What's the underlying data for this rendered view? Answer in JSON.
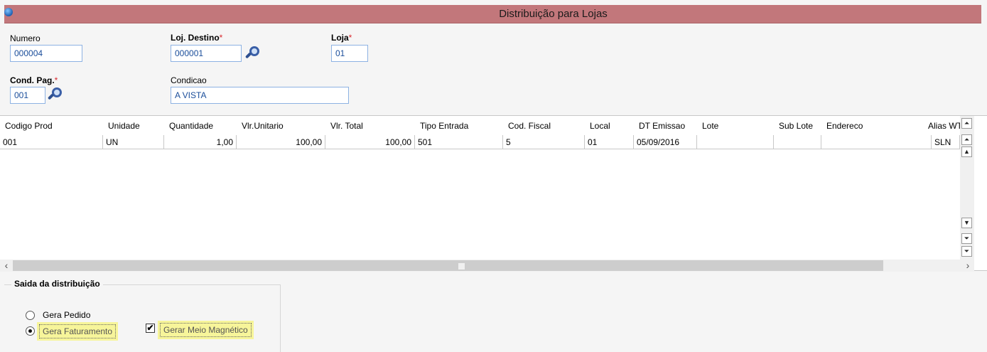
{
  "window": {
    "title": "Distribuição para Lojas"
  },
  "form": {
    "numero": {
      "label": "Numero",
      "value": "000004"
    },
    "loj_destino": {
      "label": "Loj. Destino",
      "required_mark": "*",
      "value": "000001"
    },
    "loja": {
      "label": "Loja",
      "required_mark": "*",
      "value": "01"
    },
    "cond_pag": {
      "label": "Cond. Pag.",
      "required_mark": "*",
      "value": "001"
    },
    "condicao": {
      "label": "Condicao",
      "value": "A VISTA"
    }
  },
  "grid": {
    "columns": [
      "Codigo Prod",
      "Unidade",
      "Quantidade",
      "Vlr.Unitario",
      "Vlr. Total",
      "Tipo Entrada",
      "Cod. Fiscal",
      "Local",
      "DT Emissao",
      "Lote",
      "Sub Lote",
      "Endereco",
      "Alias WT"
    ],
    "rows": [
      [
        "001",
        "UN",
        "1,00",
        "100,00",
        "100,00",
        "501",
        "5",
        "01",
        "05/09/2016",
        "",
        "",
        "",
        "SLN"
      ]
    ]
  },
  "saida": {
    "title": "Saida da distribuição",
    "gera_pedido": {
      "label": "Gera Pedido",
      "selected": false
    },
    "gera_faturamento": {
      "label": "Gera Faturamento",
      "selected": true
    },
    "gerar_meio_magnetico": {
      "label": "Gerar Meio Magnético",
      "checked": true,
      "check_glyph": "✔"
    }
  },
  "colors": {
    "title_bar": "#c2777b",
    "field_text": "#1a4d9a",
    "required": "#d8292f",
    "highlight": "#f7f59a"
  },
  "icons": [
    "app-icon",
    "search-icon",
    "scroll-up-icon",
    "scroll-down-icon",
    "scroll-left-icon",
    "scroll-right-icon"
  ]
}
